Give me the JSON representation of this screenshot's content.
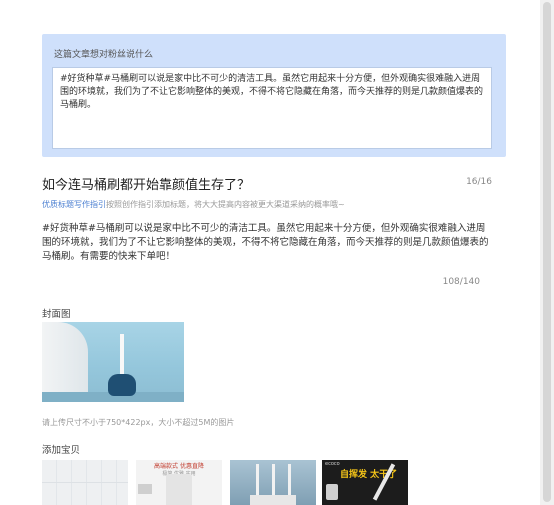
{
  "fan_section": {
    "label": "这篇文章想对粉丝说什么",
    "text": "#好货种草#马桶刷可以说是家中比不可少的清洁工具。虽然它用起来十分方便，但外观确实很难融入进周围的环境就，我们为了不让它影响整体的美观，不得不将它隐藏在角落，而今天推荐的则是几款颜值爆表的马桶刷。"
  },
  "title": {
    "text": "如今连马桶刷都开始靠颜值生存了？",
    "count": "16/16"
  },
  "hint": {
    "link": "优质标题写作指引",
    "text": "按照创作指引添加标题，将大大提高内容被更大渠道采纳的概率哦~"
  },
  "body": {
    "text": "#好货种草#马桶刷可以说是家中比不可少的清洁工具。虽然它用起来十分方便，但外观确实很难融入进周围的环境就，我们为了不让它影响整体的美观，不得不将它隐藏在角落，而今天推荐的则是几款颜值爆表的马桶刷。有需要的快来下单吧！",
    "count": "108/140"
  },
  "cover": {
    "label": "封面图",
    "upload_tip": "请上传尺寸不小于750*422px，大小不超过5M的图片"
  },
  "products": {
    "label": "添加宝贝",
    "items": [
      {
        "title": "",
        "sub": ""
      },
      {
        "title": "高端款式 优惠直降",
        "sub": "极简 优雅 实用"
      },
      {
        "title": "",
        "sub": ""
      },
      {
        "brand": "ecoco",
        "title": "自挥发 太干了"
      }
    ]
  },
  "colors": {
    "fan_bg": "#cfe0fb",
    "link": "#4b7fd1",
    "muted": "#999999"
  }
}
